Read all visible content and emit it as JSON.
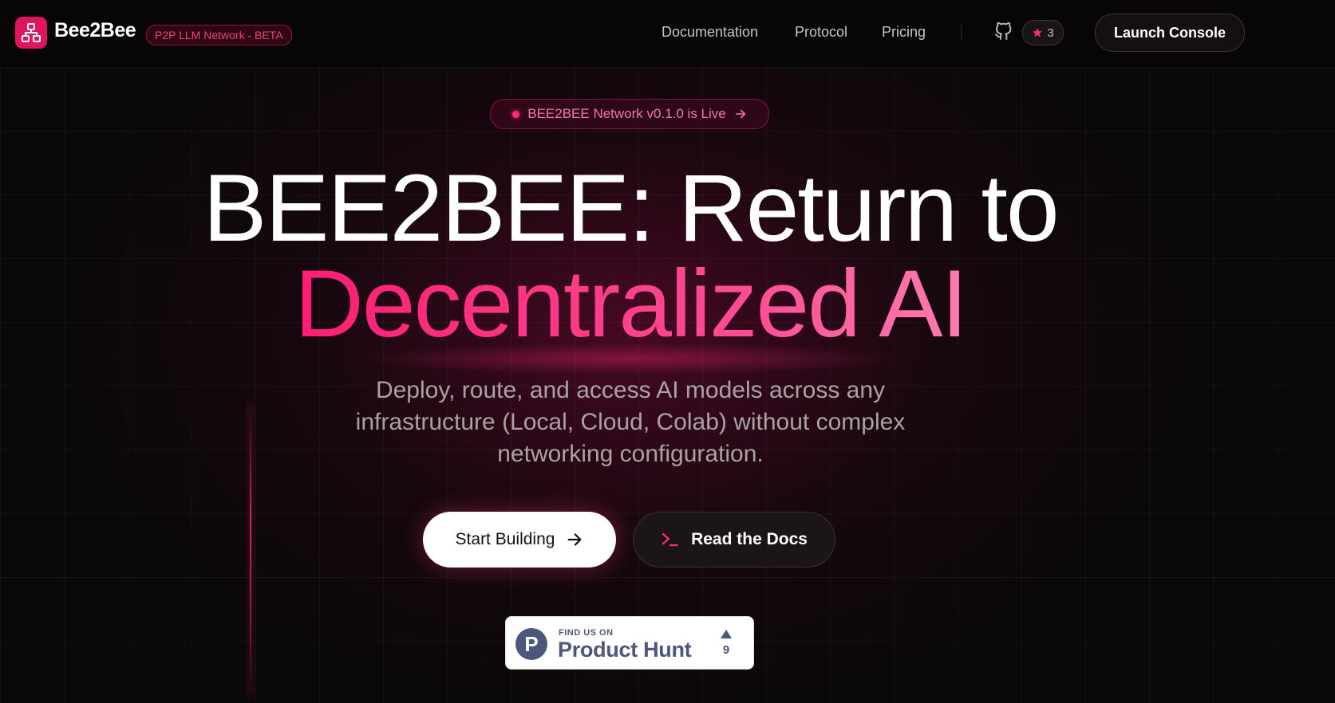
{
  "header": {
    "brand": "Bee2Bee",
    "beta_badge": "P2P LLM Network - BETA",
    "nav": [
      {
        "label": "Documentation"
      },
      {
        "label": "Protocol"
      },
      {
        "label": "Pricing"
      }
    ],
    "github_stars": "3",
    "launch_label": "Launch Console"
  },
  "hero": {
    "announcement": "BEE2BEE Network v0.1.0 is Live",
    "title_line1": "BEE2BEE: Return to",
    "title_line2": "Decentralized AI",
    "subtitle": "Deploy, route, and access AI models across any infrastructure (Local, Cloud, Colab) without complex networking configuration.",
    "primary_cta": "Start Building",
    "secondary_cta": "Read the Docs"
  },
  "product_hunt": {
    "find_us": "FIND US ON",
    "name": "Product Hunt",
    "upvotes": "9"
  },
  "colors": {
    "accent": "#e0155f",
    "background": "#0a0809",
    "product_hunt": "#4b587c"
  },
  "icons": {
    "logo": "network-hierarchy-icon",
    "github": "github-icon",
    "star": "star-icon",
    "arrow": "arrow-right-icon",
    "terminal": "terminal-icon",
    "upvote": "triangle-up-icon"
  }
}
